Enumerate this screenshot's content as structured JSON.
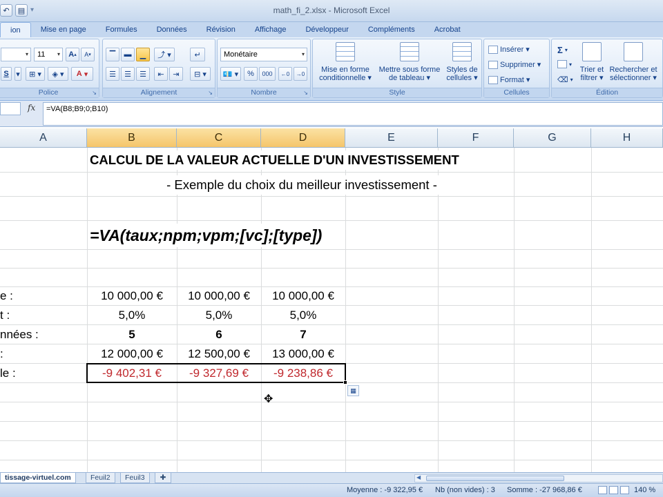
{
  "window": {
    "title": "math_fi_2.xlsx - Microsoft Excel"
  },
  "ribbon_tabs": [
    "ion",
    "Mise en page",
    "Formules",
    "Données",
    "Révision",
    "Affichage",
    "Développeur",
    "Compléments",
    "Acrobat"
  ],
  "ribbon": {
    "font_size": "11",
    "number_format": "Monétaire",
    "groups": {
      "police": "Police",
      "alignement": "Alignement",
      "nombre": "Nombre",
      "style": "Style",
      "cellules": "Cellules",
      "edition": "Édition"
    },
    "buttons": {
      "cond_format_1": "Mise en forme",
      "cond_format_2": "conditionnelle ▾",
      "table_format_1": "Mettre sous forme",
      "table_format_2": "de tableau ▾",
      "cell_styles_1": "Styles de",
      "cell_styles_2": "cellules ▾",
      "insert": "Insérer ▾",
      "delete": "Supprimer ▾",
      "format": "Format ▾",
      "sort_1": "Trier et",
      "sort_2": "filtrer ▾",
      "find_1": "Rechercher et",
      "find_2": "sélectionner ▾",
      "percent": "%",
      "thousands": "000",
      "font_grow": "A",
      "font_shrink": "A",
      "bold_partial": "S",
      "font_color": "A",
      "sigma": "Σ"
    }
  },
  "formula_bar": {
    "fx": "fx",
    "formula": "=VA(B8;B9;0;B10)"
  },
  "columns": [
    "A",
    "B",
    "C",
    "D",
    "E",
    "F",
    "G",
    "H"
  ],
  "sheet": {
    "title": "CALCUL DE LA VALEUR ACTUELLE D'UN INVESTISSEMENT",
    "subtitle": "- Exemple du choix du meilleur investissement -",
    "formula_text": "=VA(taux;npm;vpm;[vc];[type])",
    "row_labels": [
      "e :",
      "t :",
      "nnées :",
      ":",
      "le :"
    ],
    "rows": [
      [
        "10 000,00 €",
        "10 000,00 €",
        "10 000,00 €"
      ],
      [
        "5,0%",
        "5,0%",
        "5,0%"
      ],
      [
        "5",
        "6",
        "7"
      ],
      [
        "12 000,00 €",
        "12 500,00 €",
        "13 000,00 €"
      ],
      [
        "-9 402,31 €",
        "-9 327,69 €",
        "-9 238,86 €"
      ]
    ]
  },
  "sheet_tabs": [
    "tissage-virtuel.com",
    "Feuil2",
    "Feuil3"
  ],
  "status": {
    "average": "Moyenne : -9 322,95 €",
    "count": "Nb (non vides) : 3",
    "sum": "Somme : -27 968,86 €",
    "zoom": "140 %"
  }
}
